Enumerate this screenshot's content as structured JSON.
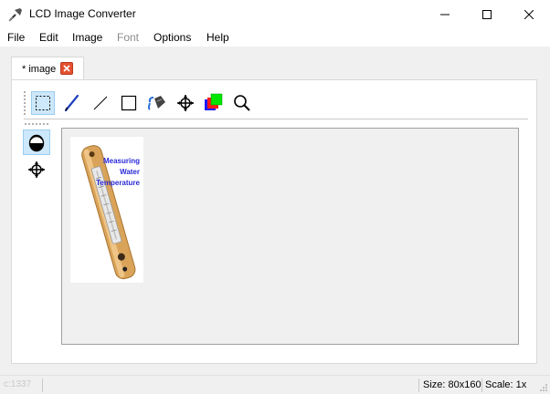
{
  "window": {
    "title": "LCD Image Converter"
  },
  "menu": {
    "items": [
      "File",
      "Edit",
      "Image",
      "Font",
      "Options",
      "Help"
    ],
    "disabled": [
      "Font"
    ]
  },
  "tabs": [
    {
      "label": "* image",
      "active": true
    }
  ],
  "toolbar": {
    "tools": [
      "select-tool",
      "pen-tool",
      "line-tool",
      "rectangle-tool",
      "fill-tool",
      "move-tool",
      "color-tool",
      "zoom-tool"
    ],
    "active_tool": "select-tool"
  },
  "side_toolbar": {
    "tools": [
      "invert-tool",
      "move-content-tool"
    ],
    "active_tool": "invert-tool"
  },
  "image": {
    "caption_lines": [
      "Measuring",
      "Water",
      "Temperature"
    ],
    "caption_color": "#2a2ad8"
  },
  "status": {
    "left": "c:1337",
    "size": "Size: 80x160",
    "scale": "Scale: 1x"
  },
  "colors": {
    "accent_selection": "#cde8fb",
    "tab_close": "#e4512f"
  }
}
